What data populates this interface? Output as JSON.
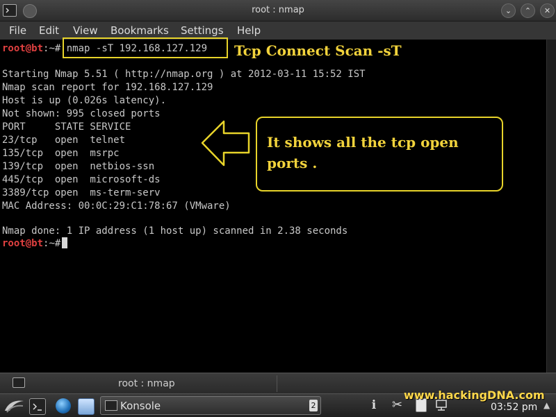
{
  "window": {
    "title": "root : nmap",
    "buttons": {
      "minimize": "⌄",
      "maximize": "⌃",
      "close": "✕"
    }
  },
  "menu": [
    "File",
    "Edit",
    "View",
    "Bookmarks",
    "Settings",
    "Help"
  ],
  "terminal": {
    "prompt_user": "root@bt",
    "prompt_suffix": ":~#",
    "command": "nmap -sT 192.168.127.129",
    "lines": [
      "Starting Nmap 5.51 ( http://nmap.org ) at 2012-03-11 15:52 IST",
      "Nmap scan report for 192.168.127.129",
      "Host is up (0.026s latency).",
      "Not shown: 995 closed ports",
      "PORT     STATE SERVICE",
      "23/tcp   open  telnet",
      "135/tcp  open  msrpc",
      "139/tcp  open  netbios-ssn",
      "445/tcp  open  microsoft-ds",
      "3389/tcp open  ms-term-serv",
      "MAC Address: 00:0C:29:C1:78:67 (VMware)",
      "",
      "Nmap done: 1 IP address (1 host up) scanned in 2.38 seconds"
    ]
  },
  "annotations": {
    "title": "Tcp Connect Scan -sT",
    "callout": "It shows all the tcp open ports ."
  },
  "tabbar": {
    "tab_label": "root : nmap"
  },
  "taskbar": {
    "task_label": "Konsole",
    "task_count": "2",
    "clock": "03:52 pm"
  },
  "watermark": "www.hackingDNA.com",
  "colors": {
    "accent": "#f2d33c",
    "prompt": "#e04040",
    "terminal_bg": "#000000"
  }
}
